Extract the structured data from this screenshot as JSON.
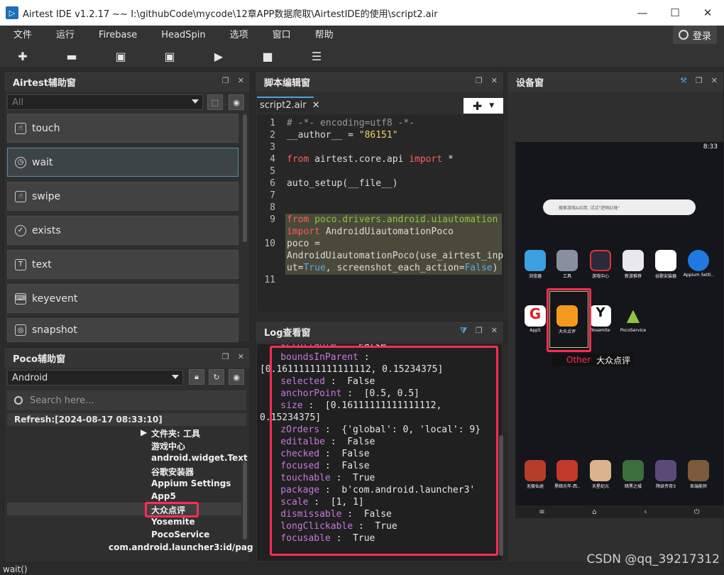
{
  "window": {
    "title": "Airtest IDE v1.2.17 ~~ I:\\githubCode\\mycode\\12章APP数据爬取\\AirtestIDE的使用\\script2.air"
  },
  "menus": [
    "文件",
    "运行",
    "Firebase",
    "HeadSpin",
    "选项",
    "窗口",
    "帮助"
  ],
  "login": "登录",
  "toolbar_icons": [
    "plus-icon",
    "folder-open-icon",
    "save-icon",
    "save-as-icon",
    "play-icon",
    "stop-icon",
    "log-icon"
  ],
  "aux": {
    "title": "Airtest辅助窗",
    "filter": "All",
    "items": [
      {
        "label": "touch",
        "icon": "hand-pointer-icon"
      },
      {
        "label": "wait",
        "icon": "clock-icon"
      },
      {
        "label": "swipe",
        "icon": "swipe-hand-icon"
      },
      {
        "label": "exists",
        "icon": "check-circle-icon"
      },
      {
        "label": "text",
        "icon": "text-box-icon"
      },
      {
        "label": "keyevent",
        "icon": "keyboard-icon"
      },
      {
        "label": "snapshot",
        "icon": "camera-icon"
      }
    ]
  },
  "poco": {
    "title": "Poco辅助窗",
    "platform": "Android",
    "search_placeholder": "Search here...",
    "refresh": "Refresh:[2024-08-17 08:33:10]",
    "tree": [
      "文件夹: 工具",
      "游戏中心",
      "android.widget.Text",
      "谷歌安装器",
      "Appium Settings",
      "App5",
      "大众点评",
      "Yosemite",
      "PocoService",
      "com.android.launcher3:id/pag"
    ]
  },
  "editor": {
    "title": "脚本编辑窗",
    "tab": "script2.air",
    "lines": {
      "l1": "# -*- encoding=utf8 -*-",
      "l2a": "__author__ = ",
      "l2b": "\"86151\"",
      "l4a": "from",
      "l4b": " airtest.core.api ",
      "l4c": "import",
      "l4d": " *",
      "l6": "auto_setup(__file__)",
      "l9a": "from",
      "l9b": " poco.drivers.android.uiautomation",
      "l9c": "import",
      "l9d": " AndroidUiautomationPoco",
      "l10a": "poco =",
      "l10b": "AndroidUiautomationPoco(use_airtest_inp",
      "l10c": "ut=",
      "l10d": "True",
      "l10e": ", screenshot_each_action=",
      "l10f": "False",
      "l10g": ")"
    },
    "numbers": [
      "1",
      "2",
      "3",
      "4",
      "5",
      "6",
      "7",
      "8",
      "9",
      "10",
      "11"
    ]
  },
  "log": {
    "title": "Log查看窗",
    "rows": [
      {
        "k": "    scrollable",
        "v": " :  False"
      },
      {
        "k": "    boundsInParent",
        "v": " :"
      },
      {
        "k": "",
        "v": "[0.16111111111111112, 0.15234375]"
      },
      {
        "k": "    selected",
        "v": " :  False"
      },
      {
        "k": "    anchorPoint",
        "v": " :  [0.5, 0.5]"
      },
      {
        "k": "    size",
        "v": " :  [0.16111111111111112,"
      },
      {
        "k": "",
        "v": "0.15234375]"
      },
      {
        "k": "    zOrders",
        "v": " :  {'global': 0, 'local': 9}"
      },
      {
        "k": "    editalbe",
        "v": " :  False"
      },
      {
        "k": "    checked",
        "v": " :  False"
      },
      {
        "k": "    focused",
        "v": " :  False"
      },
      {
        "k": "    touchable",
        "v": " :  True"
      },
      {
        "k": "    package",
        "v": " :  b'com.android.launcher3'"
      },
      {
        "k": "    scale",
        "v": " :  [1, 1]"
      },
      {
        "k": "    dismissable",
        "v": " :  False"
      },
      {
        "k": "    longClickable",
        "v": " :  True"
      },
      {
        "k": "    focusable",
        "v": " :  True"
      }
    ]
  },
  "device": {
    "title": "设备窗",
    "time": "8:33",
    "search_hint": "搜索游戏&应用, 试试\"逆明幻境\"",
    "row1": [
      "浏览器",
      "工具",
      "游戏中心",
      "新游推荐",
      "谷歌安装器",
      "Appium Setti.."
    ],
    "row2": [
      "App5",
      "大众点评",
      "Yosemite",
      "PocoService"
    ],
    "dock": [
      "无极仙途",
      "黑暗光年-西..",
      "天星纪元",
      "暗黑之城",
      "降妖传奇3",
      "各端能师"
    ],
    "tooltip_type": "Other",
    "tooltip_name": "大众点评"
  },
  "statusbar": "wait()",
  "watermark": "CSDN @qq_39217312",
  "colors": {
    "highlight_red": "#ff2d55",
    "accent_blue": "#4aa3df"
  }
}
